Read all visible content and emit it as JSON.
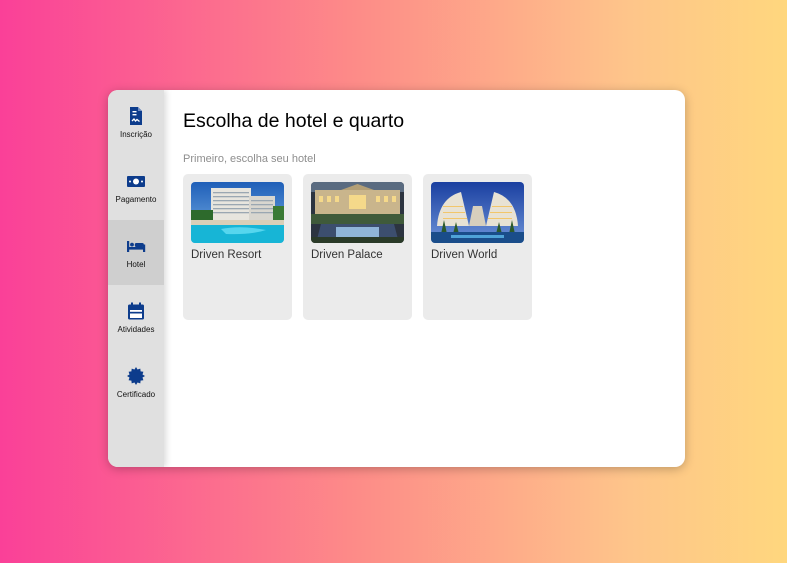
{
  "sidebar": {
    "items": [
      {
        "label": "Inscrição",
        "icon": "file-contract-icon",
        "active": false
      },
      {
        "label": "Pagamento",
        "icon": "money-bill-icon",
        "active": false
      },
      {
        "label": "Hotel",
        "icon": "bed-icon",
        "active": true
      },
      {
        "label": "Atividades",
        "icon": "calendar-icon",
        "active": false
      },
      {
        "label": "Certificado",
        "icon": "certificate-icon",
        "active": false
      }
    ]
  },
  "main": {
    "title": "Escolha de hotel e quarto",
    "subtitle": "Primeiro, escolha seu hotel",
    "hotels": [
      {
        "name": "Driven Resort"
      },
      {
        "name": "Driven Palace"
      },
      {
        "name": "Driven World"
      }
    ]
  },
  "colors": {
    "icon": "#0d3c8c",
    "sidebar_bg": "#e0e0e0",
    "sidebar_active": "#cfcfcf",
    "card_bg": "#ebebeb"
  }
}
